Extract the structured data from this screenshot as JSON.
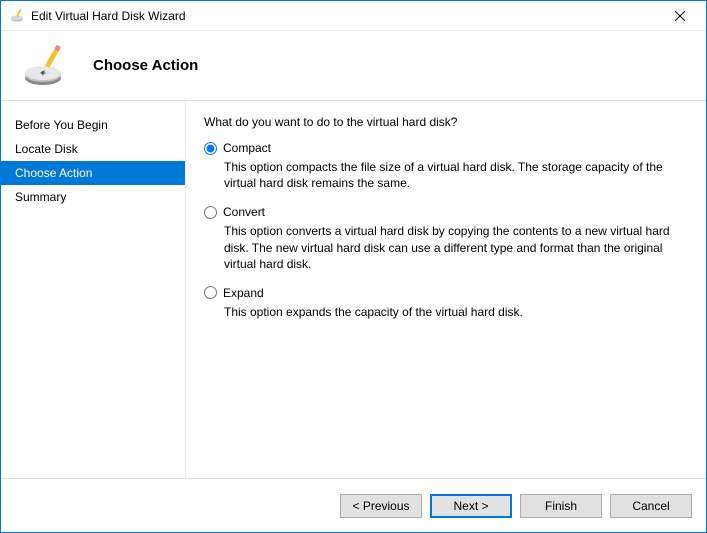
{
  "window": {
    "title": "Edit Virtual Hard Disk Wizard"
  },
  "header": {
    "title": "Choose Action"
  },
  "sidebar": {
    "steps": [
      {
        "label": "Before You Begin",
        "active": false
      },
      {
        "label": "Locate Disk",
        "active": false
      },
      {
        "label": "Choose Action",
        "active": true
      },
      {
        "label": "Summary",
        "active": false
      }
    ]
  },
  "content": {
    "prompt": "What do you want to do to the virtual hard disk?",
    "options": [
      {
        "label": "Compact",
        "description": "This option compacts the file size of a virtual hard disk. The storage capacity of the virtual hard disk remains the same.",
        "selected": true
      },
      {
        "label": "Convert",
        "description": "This option converts a virtual hard disk by copying the contents to a new virtual hard disk. The new virtual hard disk can use a different type and format than the original virtual hard disk.",
        "selected": false
      },
      {
        "label": "Expand",
        "description": "This option expands the capacity of the virtual hard disk.",
        "selected": false
      }
    ]
  },
  "footer": {
    "previous": "< Previous",
    "next": "Next >",
    "finish": "Finish",
    "cancel": "Cancel"
  }
}
